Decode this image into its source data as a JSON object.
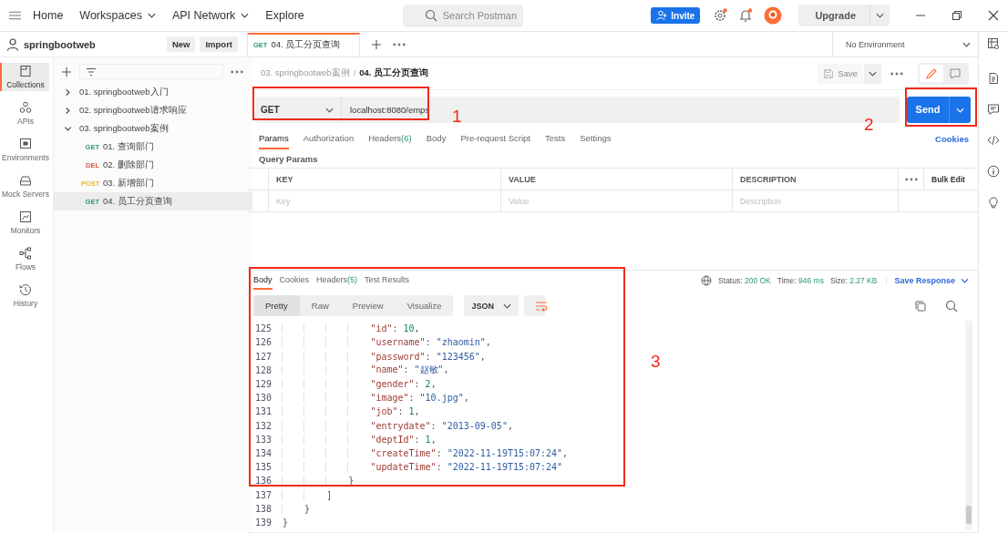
{
  "top_nav": {
    "items": [
      {
        "label": "Home",
        "dropdown": false
      },
      {
        "label": "Workspaces",
        "dropdown": true
      },
      {
        "label": "API Network",
        "dropdown": true
      },
      {
        "label": "Explore",
        "dropdown": false
      }
    ],
    "search": {
      "placeholder": "Search Postman"
    },
    "invite": "Invite",
    "upgrade": "Upgrade"
  },
  "workspace": {
    "name": "springbootweb",
    "buttons": [
      "New",
      "Import"
    ]
  },
  "sidebar": {
    "items": [
      {
        "label": "Collections",
        "selected": true
      },
      {
        "label": "APIs",
        "selected": false
      },
      {
        "label": "Environments",
        "selected": false
      },
      {
        "label": "Mock Servers",
        "selected": false
      },
      {
        "label": "Monitors",
        "selected": false
      },
      {
        "label": "Flows",
        "selected": false
      },
      {
        "label": "History",
        "selected": false
      }
    ]
  },
  "tree": [
    {
      "label": "01. springbootweb入门",
      "expanded": false
    },
    {
      "label": "02. springbootweb请求响应",
      "expanded": false
    },
    {
      "label": "03. springbootweb案例",
      "expanded": true,
      "children": [
        {
          "method": "GET",
          "color": "#2e9b6a",
          "label": "01. 查询部门",
          "selected": false
        },
        {
          "method": "DEL",
          "color": "#e0524a",
          "label": "02. 删除部门",
          "selected": false
        },
        {
          "method": "POST",
          "color": "#e8b630",
          "label": "03. 新增部门",
          "selected": false
        },
        {
          "method": "GET",
          "color": "#2e9b6a",
          "label": "04. 员工分页查询",
          "selected": true
        }
      ]
    }
  ],
  "open_tab": {
    "method": "GET",
    "label": "04. 员工分页查询"
  },
  "environment": "No Environment",
  "breadcrumb": {
    "items": [
      "03. springbootweb案例",
      "04. 员工分页查询"
    ],
    "separator": "/"
  },
  "save": "Save",
  "view_toggle": [
    {
      "selected": true
    },
    {
      "selected": false
    }
  ],
  "request": {
    "method": "GET",
    "url": "localhost:8080/emps",
    "send": "Send"
  },
  "request_tabs": [
    {
      "label": "Params",
      "selected": true
    },
    {
      "label": "Authorization",
      "selected": false
    },
    {
      "label": "Headers",
      "count": "(6)",
      "selected": false
    },
    {
      "label": "Body",
      "selected": false
    },
    {
      "label": "Pre-request Script",
      "selected": false
    },
    {
      "label": "Tests",
      "selected": false
    },
    {
      "label": "Settings",
      "selected": false
    }
  ],
  "cookies": "Cookies",
  "query_params": {
    "title": "Query Params",
    "columns": [
      "KEY",
      "VALUE",
      "DESCRIPTION"
    ],
    "bulk_edit": "Bulk Edit",
    "placeholders": [
      "Key",
      "Value",
      "Description"
    ]
  },
  "response_tabs": [
    {
      "label": "Body",
      "selected": true
    },
    {
      "label": "Cookies",
      "selected": false
    },
    {
      "label": "Headers",
      "count": "(5)",
      "selected": false
    },
    {
      "label": "Test Results",
      "selected": false
    }
  ],
  "status": [
    {
      "label": "Status:",
      "value": "200 OK"
    },
    {
      "label": "Time:",
      "value": "946 ms"
    },
    {
      "label": "Size:",
      "value": "2.27 KB"
    }
  ],
  "save_response": "Save Response",
  "view_modes": [
    {
      "label": "Pretty",
      "selected": true
    },
    {
      "label": "Raw",
      "selected": false
    },
    {
      "label": "Preview",
      "selected": false
    },
    {
      "label": "Visualize",
      "selected": false
    }
  ],
  "format": "JSON",
  "code": [
    {
      "number": "125",
      "tokens": [
        {
          "kind": "key",
          "text": "                \"id\""
        },
        {
          "kind": "punct",
          "text": ": "
        },
        {
          "kind": "number",
          "text": "10"
        },
        {
          "kind": "punct",
          "text": ","
        }
      ]
    },
    {
      "number": "126",
      "tokens": [
        {
          "kind": "key",
          "text": "                \"username\""
        },
        {
          "kind": "punct",
          "text": ": "
        },
        {
          "kind": "string",
          "text": "\"zhaomin\""
        },
        {
          "kind": "punct",
          "text": ","
        }
      ]
    },
    {
      "number": "127",
      "tokens": [
        {
          "kind": "key",
          "text": "                \"password\""
        },
        {
          "kind": "punct",
          "text": ": "
        },
        {
          "kind": "string",
          "text": "\"123456\""
        },
        {
          "kind": "punct",
          "text": ","
        }
      ]
    },
    {
      "number": "128",
      "tokens": [
        {
          "kind": "key",
          "text": "                \"name\""
        },
        {
          "kind": "punct",
          "text": ": "
        },
        {
          "kind": "string",
          "text": "\"赵敏\""
        },
        {
          "kind": "punct",
          "text": ","
        }
      ]
    },
    {
      "number": "129",
      "tokens": [
        {
          "kind": "key",
          "text": "                \"gender\""
        },
        {
          "kind": "punct",
          "text": ": "
        },
        {
          "kind": "number",
          "text": "2"
        },
        {
          "kind": "punct",
          "text": ","
        }
      ]
    },
    {
      "number": "130",
      "tokens": [
        {
          "kind": "key",
          "text": "                \"image\""
        },
        {
          "kind": "punct",
          "text": ": "
        },
        {
          "kind": "string",
          "text": "\"10.jpg\""
        },
        {
          "kind": "punct",
          "text": ","
        }
      ]
    },
    {
      "number": "131",
      "tokens": [
        {
          "kind": "key",
          "text": "                \"job\""
        },
        {
          "kind": "punct",
          "text": ": "
        },
        {
          "kind": "number",
          "text": "1"
        },
        {
          "kind": "punct",
          "text": ","
        }
      ]
    },
    {
      "number": "132",
      "tokens": [
        {
          "kind": "key",
          "text": "                \"entrydate\""
        },
        {
          "kind": "punct",
          "text": ": "
        },
        {
          "kind": "string",
          "text": "\"2013-09-05\""
        },
        {
          "kind": "punct",
          "text": ","
        }
      ]
    },
    {
      "number": "133",
      "tokens": [
        {
          "kind": "key",
          "text": "                \"deptId\""
        },
        {
          "kind": "punct",
          "text": ": "
        },
        {
          "kind": "number",
          "text": "1"
        },
        {
          "kind": "punct",
          "text": ","
        }
      ]
    },
    {
      "number": "134",
      "tokens": [
        {
          "kind": "key",
          "text": "                \"createTime\""
        },
        {
          "kind": "punct",
          "text": ": "
        },
        {
          "kind": "string",
          "text": "\"2022-11-19T15:07:24\""
        },
        {
          "kind": "punct",
          "text": ","
        }
      ]
    },
    {
      "number": "135",
      "tokens": [
        {
          "kind": "key",
          "text": "                \"updateTime\""
        },
        {
          "kind": "punct",
          "text": ": "
        },
        {
          "kind": "string",
          "text": "\"2022-11-19T15:07:24\""
        }
      ]
    },
    {
      "number": "136",
      "tokens": [
        {
          "kind": "punct",
          "text": "            }"
        }
      ]
    },
    {
      "number": "137",
      "tokens": [
        {
          "kind": "punct",
          "text": "        ]"
        }
      ]
    },
    {
      "number": "138",
      "tokens": [
        {
          "kind": "punct",
          "text": "    }"
        }
      ]
    },
    {
      "number": "139",
      "tokens": [
        {
          "kind": "punct",
          "text": "}"
        }
      ]
    }
  ],
  "annotations": [
    {
      "label": "1"
    },
    {
      "label": "2"
    },
    {
      "label": "3"
    }
  ]
}
